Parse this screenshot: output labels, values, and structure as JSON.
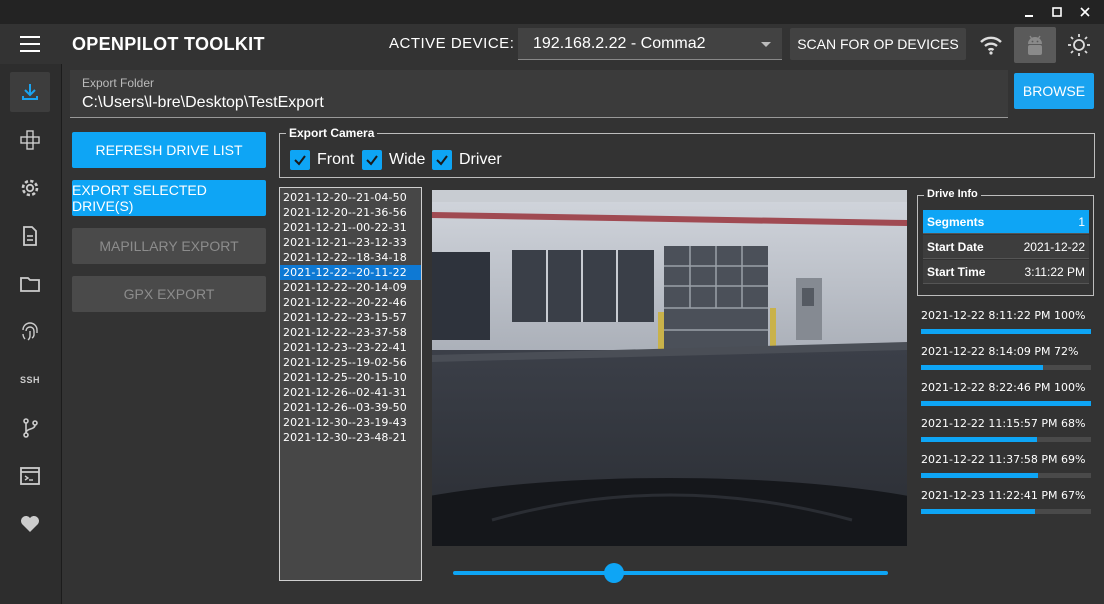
{
  "window": {
    "minimize_icon": "minimize-icon",
    "maximize_icon": "maximize-icon",
    "close_icon": "close-icon"
  },
  "header": {
    "title": "OPENPILOT TOOLKIT",
    "active_device_label": "ACTIVE DEVICE:",
    "active_device_value": "192.168.2.22 - Comma2",
    "scan_button": "SCAN FOR OP DEVICES"
  },
  "sidebar": {
    "items": [
      {
        "name": "download-icon",
        "active": true
      },
      {
        "name": "gamepad-icon",
        "active": false
      },
      {
        "name": "gear-icon",
        "active": false
      },
      {
        "name": "document-icon",
        "active": false
      },
      {
        "name": "folder-icon",
        "active": false
      },
      {
        "name": "fingerprint-icon",
        "active": false
      },
      {
        "name": "ssh-icon",
        "label": "SSH",
        "active": false
      },
      {
        "name": "git-branch-icon",
        "active": false
      },
      {
        "name": "terminal-icon",
        "active": false
      },
      {
        "name": "heart-icon",
        "active": false
      }
    ]
  },
  "export_folder": {
    "label": "Export Folder",
    "value": "C:\\Users\\l-bre\\Desktop\\TestExport",
    "browse_button": "BROWSE"
  },
  "actions": {
    "refresh": "REFRESH DRIVE LIST",
    "export_selected": "EXPORT SELECTED DRIVE(S)",
    "mapillary": "MAPILLARY EXPORT",
    "gpx": "GPX EXPORT"
  },
  "export_camera": {
    "legend": "Export Camera",
    "options": [
      {
        "label": "Front",
        "checked": true
      },
      {
        "label": "Wide",
        "checked": true
      },
      {
        "label": "Driver",
        "checked": true
      }
    ]
  },
  "drives": [
    "2021-12-20--21-04-50",
    "2021-12-20--21-36-56",
    "2021-12-21--00-22-31",
    "2021-12-21--23-12-33",
    "2021-12-22--18-34-18",
    "2021-12-22--20-11-22",
    "2021-12-22--20-14-09",
    "2021-12-22--20-22-46",
    "2021-12-22--23-15-57",
    "2021-12-22--23-37-58",
    "2021-12-23--23-22-41",
    "2021-12-25--19-02-56",
    "2021-12-25--20-15-10",
    "2021-12-26--02-41-31",
    "2021-12-26--03-39-50",
    "2021-12-30--23-19-43",
    "2021-12-30--23-48-21"
  ],
  "selected_drive_index": 5,
  "video": {
    "slider_position": 0.37
  },
  "drive_info": {
    "legend": "Drive Info",
    "rows": [
      {
        "key": "Segments",
        "value": "1"
      },
      {
        "key": "Start Date",
        "value": "2021-12-22"
      },
      {
        "key": "Start Time",
        "value": "3:11:22 PM"
      }
    ]
  },
  "progress": [
    {
      "date": "2021-12-22 8:11:22",
      "suffix": "PM 100%",
      "value": 1.0
    },
    {
      "date": "2021-12-22 8:14:09",
      "suffix": "PM 72%",
      "value": 0.72
    },
    {
      "date": "2021-12-22 8:22:46",
      "suffix": "PM 100%",
      "value": 1.0
    },
    {
      "date": "2021-12-22 11:15:57",
      "suffix": "PM 68%",
      "value": 0.68
    },
    {
      "date": "2021-12-22 11:37:58",
      "suffix": "PM 69%",
      "value": 0.69
    },
    {
      "date": "2021-12-23 11:22:41",
      "suffix": "PM 67%",
      "value": 0.67
    }
  ],
  "colors": {
    "accent": "#0ea5f5",
    "selected": "#0e79d4",
    "background": "#333333"
  }
}
